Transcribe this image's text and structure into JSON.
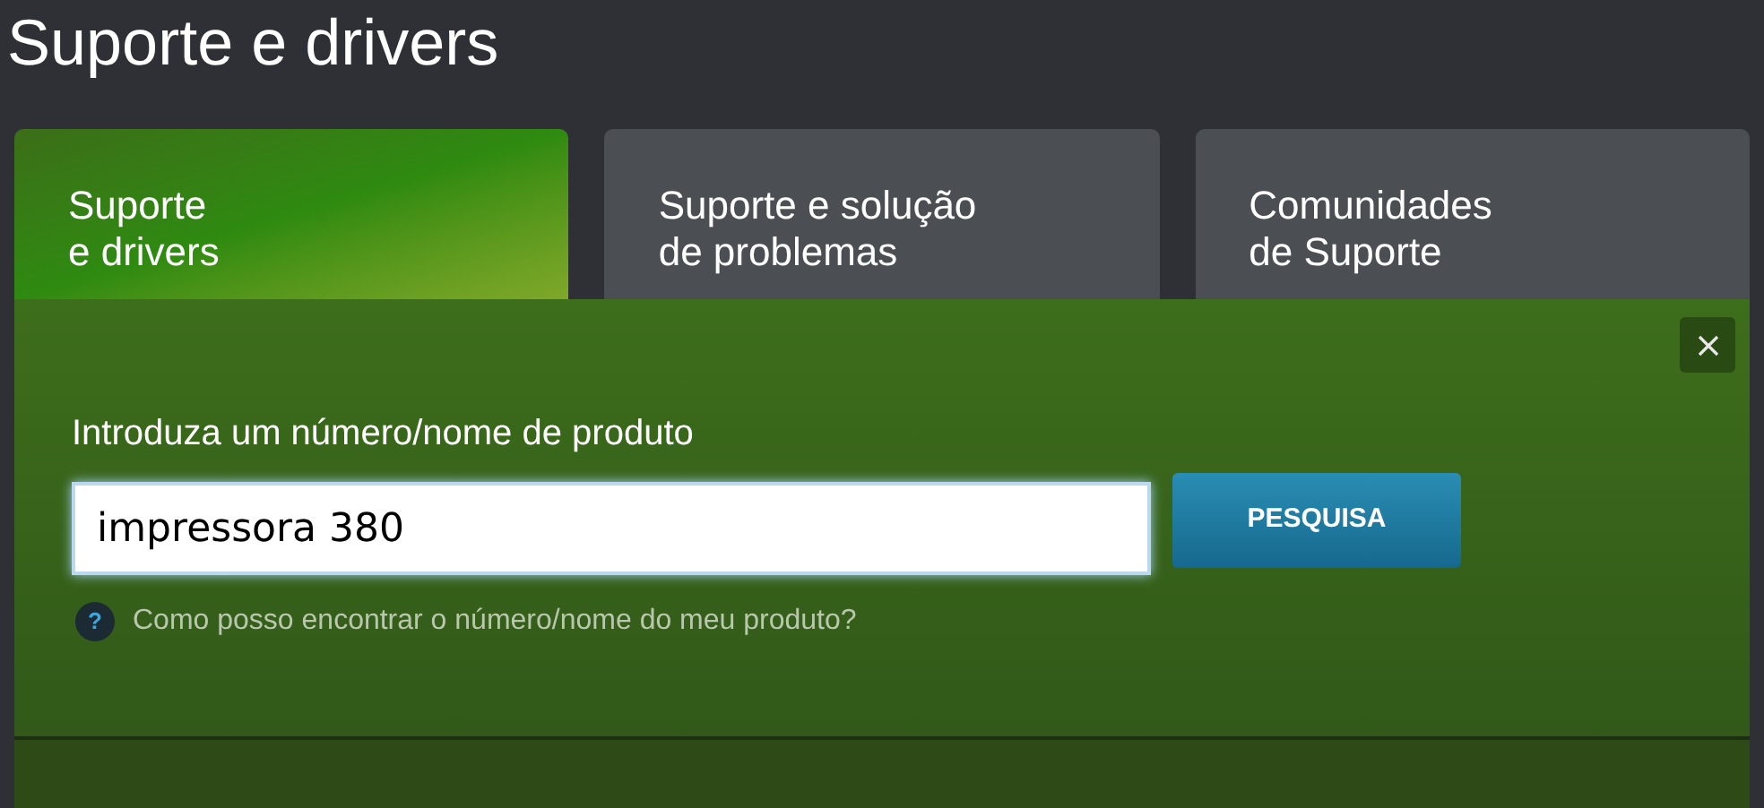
{
  "title": "Suporte e drivers",
  "tabs": [
    {
      "label": "Suporte\ne drivers",
      "selected": true
    },
    {
      "label": "Suporte e solução\nde problemas",
      "selected": false
    },
    {
      "label": "Comunidades\nde Suporte",
      "selected": false
    }
  ],
  "search": {
    "label": "Introduza um número/nome de produto",
    "value": "impressora 380",
    "button": "PESQUISA"
  },
  "help": {
    "icon": "?",
    "text": "Como posso encontrar o número/nome do meu produto?"
  }
}
